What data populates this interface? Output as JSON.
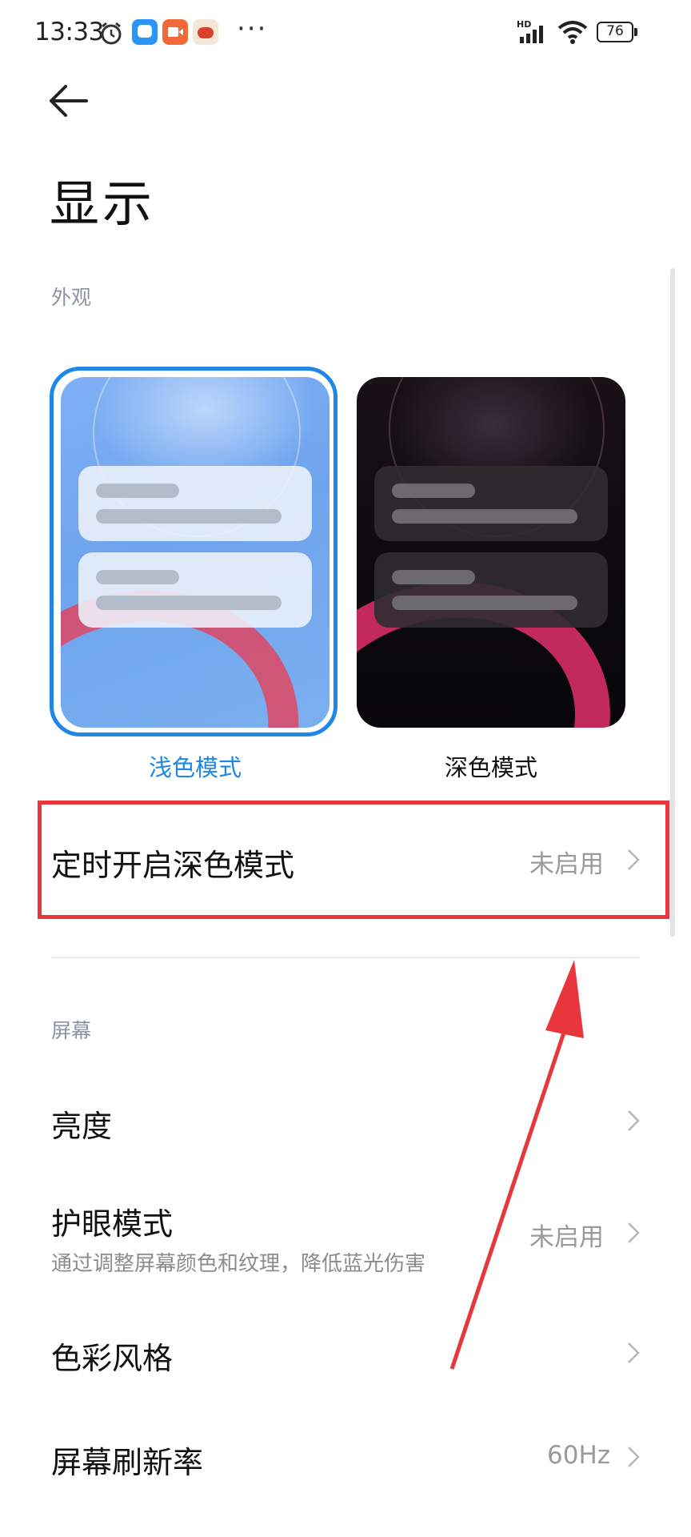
{
  "status_bar": {
    "time": "13:33",
    "network": "HD",
    "battery": "76"
  },
  "header": {
    "title": "显示"
  },
  "appearance": {
    "section_label": "外观",
    "light_mode_label": "浅色模式",
    "dark_mode_label": "深色模式",
    "selected": "light",
    "accent_color": "#1f87e5"
  },
  "scheduled_dark": {
    "title": "定时开启深色模式",
    "value": "未启用"
  },
  "screen": {
    "section_label": "屏幕",
    "items": [
      {
        "title": "亮度",
        "value": ""
      },
      {
        "title": "护眼模式",
        "subtitle": "通过调整屏幕颜色和纹理，降低蓝光伤害",
        "value": "未启用"
      },
      {
        "title": "色彩风格",
        "value": ""
      },
      {
        "title": "屏幕刷新率",
        "value": "60Hz"
      }
    ]
  },
  "annotation_color": "#e8363c"
}
